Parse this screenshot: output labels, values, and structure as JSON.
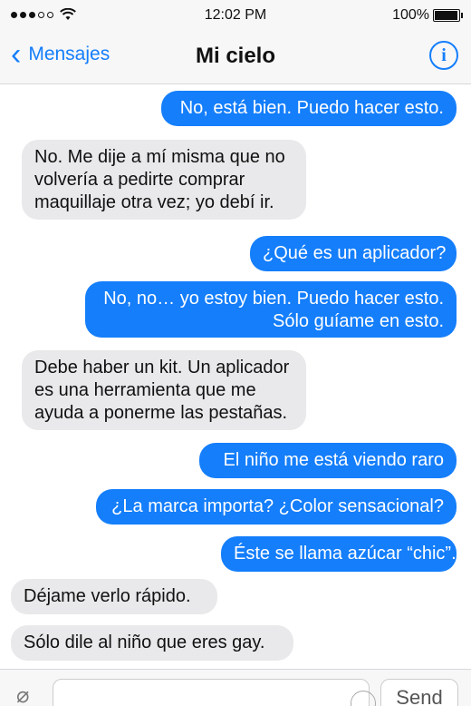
{
  "status_bar": {
    "time": "12:02 PM",
    "battery_text": "100%",
    "battery_level": 1.0
  },
  "nav": {
    "back_label": "Mensajes",
    "title": "Mi cielo",
    "info_icon": "info-icon"
  },
  "messages": [
    {
      "type": "sent",
      "lines": [
        "No, está bien. Puedo hacer esto."
      ]
    },
    {
      "type": "received",
      "lines": [
        "No. Me dije a mí misma que no",
        "volvería a pedirte comprar",
        "maquillaje otra vez; yo debí ir."
      ]
    },
    {
      "type": "sent",
      "lines": [
        "¿Qué es un aplicador?"
      ]
    },
    {
      "type": "sent",
      "lines": [
        "No, no… yo estoy bien. Puedo hacer esto.",
        "Sólo guíame en esto."
      ]
    },
    {
      "type": "received",
      "lines": [
        "Debe haber un kit. Un aplicador",
        "es una herramienta que me",
        "ayuda a ponerme las pestañas."
      ]
    },
    {
      "type": "sent",
      "lines": [
        "El niño me está viendo raro"
      ]
    },
    {
      "type": "sent",
      "lines": [
        "¿La marca importa? ¿Color sensacional?"
      ]
    },
    {
      "type": "sent",
      "lines": [
        "Éste se llama azúcar “chic”."
      ]
    },
    {
      "type": "received",
      "lines": [
        "Déjame verlo rápido."
      ]
    },
    {
      "type": "received",
      "lines": [
        "Sólo dile al niño que eres gay."
      ]
    }
  ],
  "input_bar": {
    "send_label": "Send"
  }
}
